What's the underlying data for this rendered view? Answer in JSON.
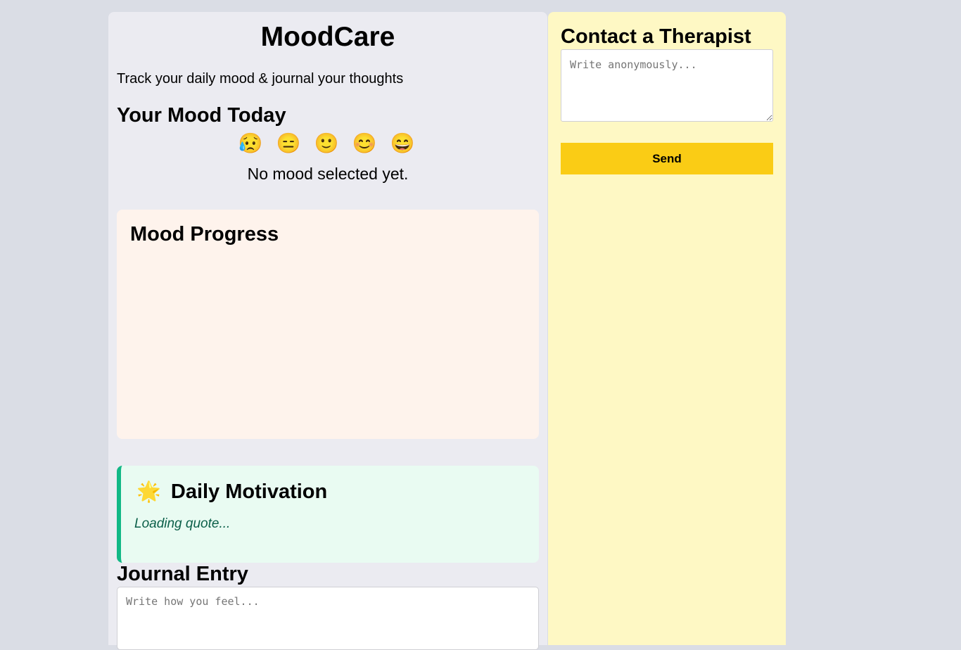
{
  "app": {
    "title": "MoodCare",
    "tagline": "Track your daily mood & journal your thoughts"
  },
  "mood": {
    "heading": "Your Mood Today",
    "options": [
      {
        "emoji": "😥",
        "icon": "crying-face-icon"
      },
      {
        "emoji": "😑",
        "icon": "neutral-face-icon"
      },
      {
        "emoji": "🙂",
        "icon": "slight-smile-face-icon"
      },
      {
        "emoji": "😊",
        "icon": "smiling-face-icon"
      },
      {
        "emoji": "😄",
        "icon": "grinning-face-icon"
      }
    ],
    "status": "No mood selected yet."
  },
  "progress": {
    "heading": "Mood Progress"
  },
  "motivation": {
    "icon": "🌟",
    "heading": "Daily Motivation",
    "quote": "Loading quote..."
  },
  "journal": {
    "heading": "Journal Entry",
    "placeholder": "Write how you feel..."
  },
  "therapist": {
    "heading": "Contact a Therapist",
    "placeholder": "Write anonymously...",
    "send_label": "Send"
  },
  "colors": {
    "page_bg": "#dadde5",
    "main_panel_bg": "#ebebf1",
    "side_panel_bg": "#fef8c4",
    "progress_card_bg": "#fef3ec",
    "motivation_card_bg": "#e9fbf2",
    "motivation_accent": "#12b886",
    "send_button": "#facc15"
  }
}
